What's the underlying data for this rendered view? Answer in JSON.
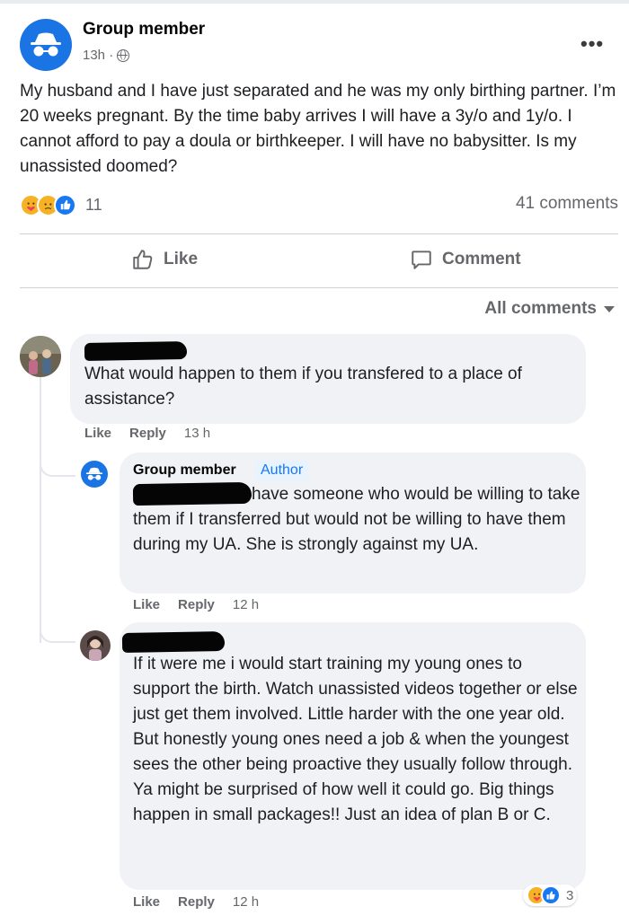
{
  "post": {
    "author": "Group member",
    "time": "13h ·",
    "text": "My husband and I have just separated and he was my only birthing partner. I’m 20 weeks pregnant. By the time baby arrives I will have a 3y/o and 1y/o. I cannot afford to pay a doula or birthkeeper. I will have no babysitter. Is my unassisted doomed?",
    "reaction_count": "11",
    "comments_count": "41 comments",
    "reactions": [
      "care-emoji",
      "sad-emoji",
      "like-emoji"
    ]
  },
  "actions": {
    "like": "Like",
    "comment": "Comment"
  },
  "all_comments": "All comments",
  "comments": [
    {
      "text": "What would happen to them if you transfered to a place of assistance?",
      "like": "Like",
      "reply": "Reply",
      "time": "13 h"
    },
    {
      "author": "Group member",
      "badge": "Author",
      "text": "have someone who would be willing to take them if I transferred but would not be willing to have them during my UA. She is strongly against my UA.",
      "like": "Like",
      "reply": "Reply",
      "time": "12 h"
    },
    {
      "text": "If it were me i would start training my young ones to support the birth. Watch unassisted videos together or else just get them involved. Little harder with the one year old. But honestly young ones need a job & when the youngest sees the other being proactive they usually follow through. Ya might be surprised of how well it could go. Big things happen in small packages!! Just an idea of plan B or C.",
      "like": "Like",
      "reply": "Reply",
      "time": "12 h",
      "reaction_count": "3"
    }
  ],
  "colors": {
    "brand_blue": "#1877f2",
    "anon_avatar_blue": "#1b74e4",
    "bubble_gray": "#f0f2f5",
    "secondary_text": "#65676b"
  }
}
